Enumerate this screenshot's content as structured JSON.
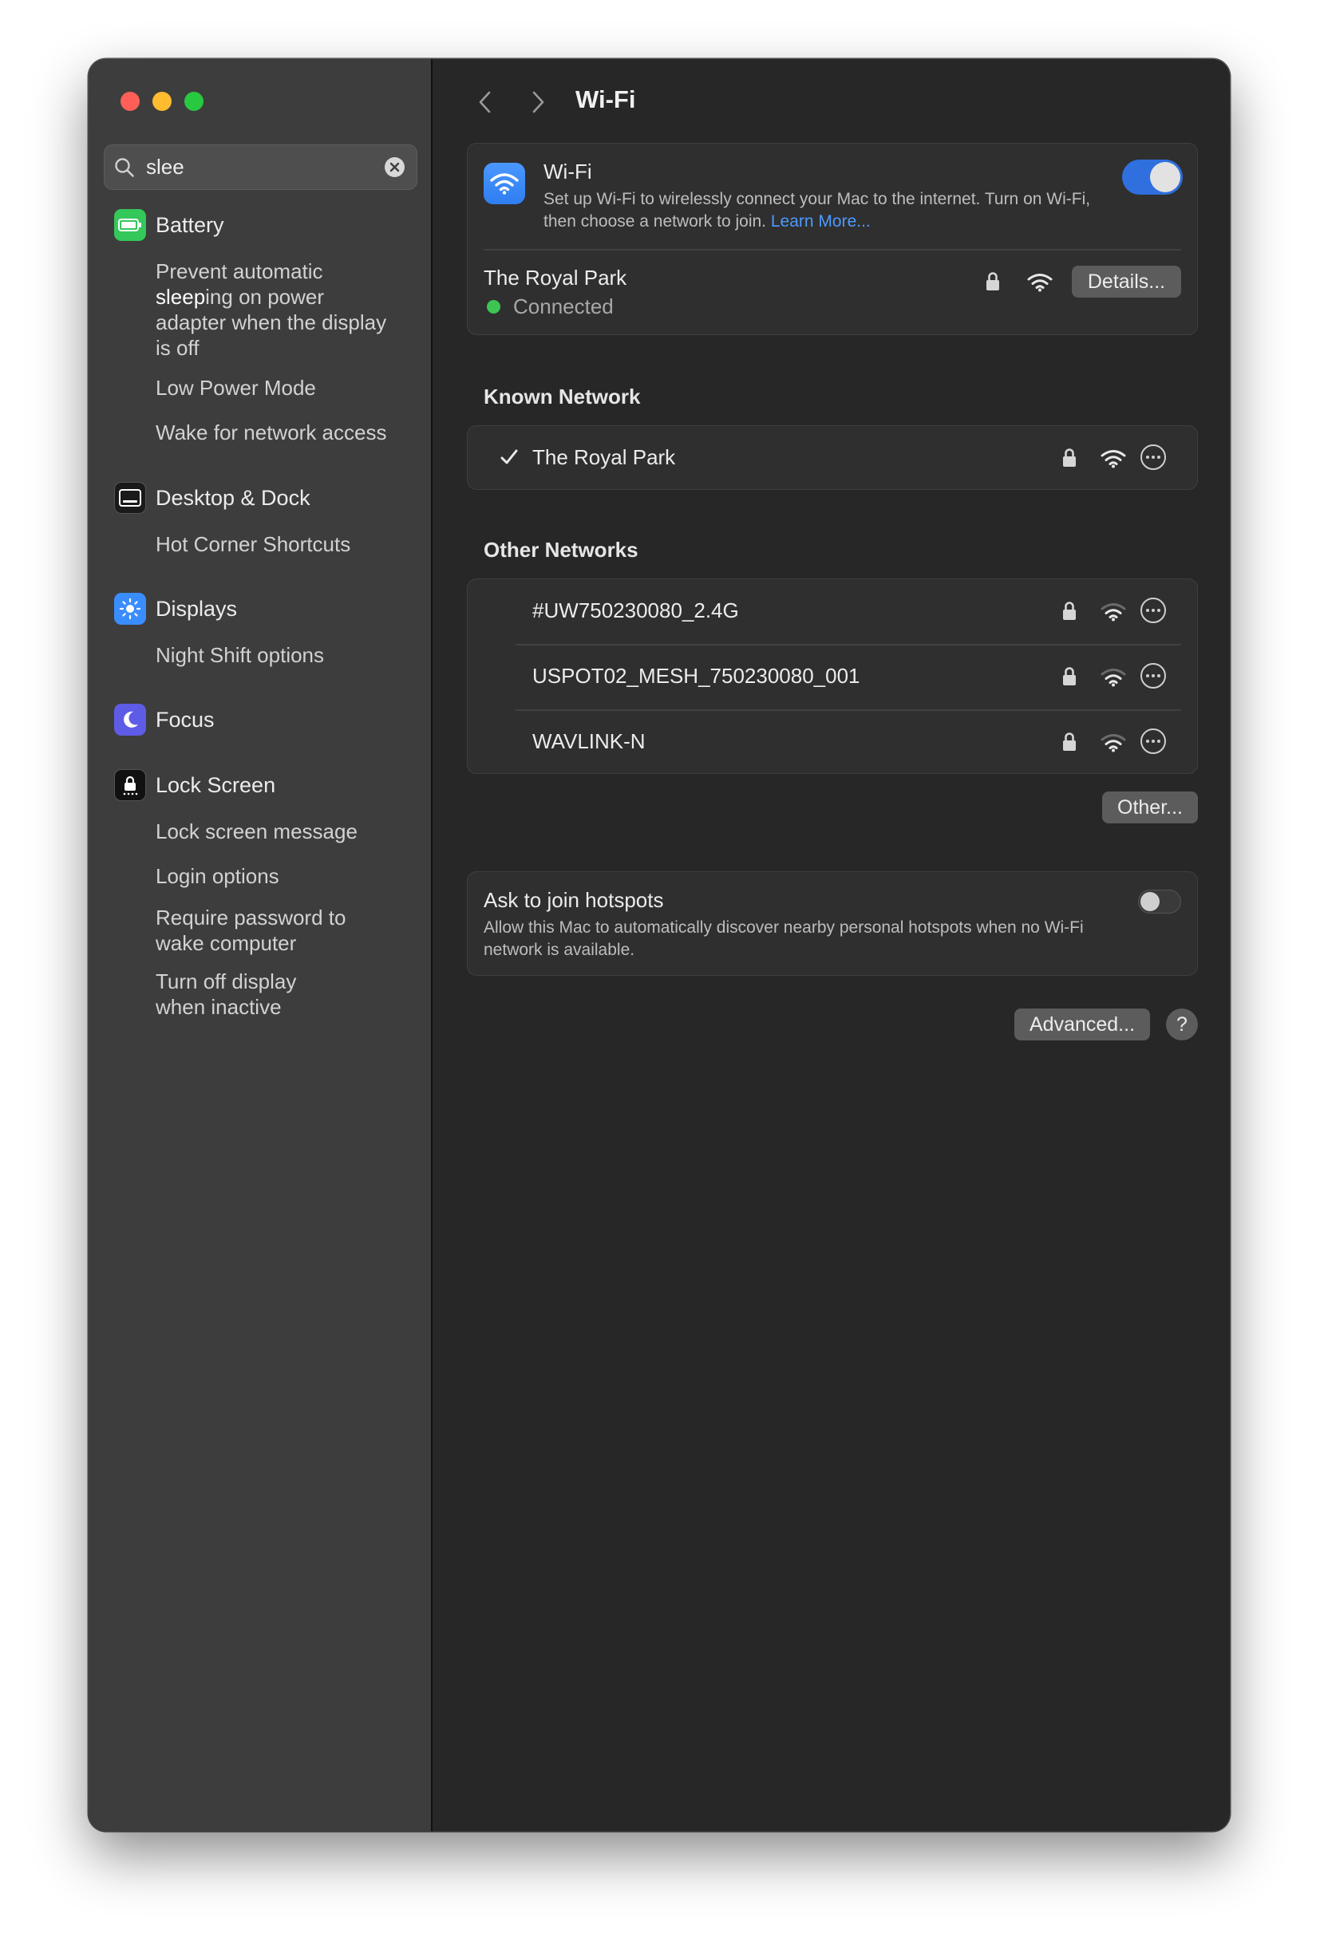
{
  "sidebar": {
    "search": {
      "value": "slee"
    },
    "groups": [
      {
        "label": "Battery",
        "icon": "battery-icon",
        "items": [
          {
            "lines": [
              [
                "Prevent automatic",
                ""
              ],
              [
                "sleep",
                "ing on power"
              ],
              [
                "adapter when the display",
                ""
              ],
              [
                "is off",
                ""
              ]
            ]
          },
          {
            "label": "Low Power Mode"
          },
          {
            "label": "Wake for network access"
          }
        ]
      },
      {
        "label": "Desktop & Dock",
        "icon": "dock-icon",
        "items": [
          {
            "label": "Hot Corner Shortcuts"
          }
        ]
      },
      {
        "label": "Displays",
        "icon": "sun-icon",
        "items": [
          {
            "label": "Night Shift options"
          }
        ]
      },
      {
        "label": "Focus",
        "icon": "moon-icon",
        "items": []
      },
      {
        "label": "Lock Screen",
        "icon": "lock-screen-icon",
        "items": [
          {
            "label": "Lock screen message"
          },
          {
            "label": "Login options"
          },
          {
            "lines": [
              [
                "Require password to",
                ""
              ],
              [
                "wake computer",
                ""
              ]
            ]
          },
          {
            "lines": [
              [
                "Turn off display",
                ""
              ],
              [
                "when inactive",
                ""
              ]
            ]
          }
        ]
      }
    ]
  },
  "main": {
    "title": "Wi-Fi",
    "wifi": {
      "title": "Wi-Fi",
      "description": "Set up Wi-Fi to wirelessly connect your Mac to the internet. Turn on Wi-Fi, then choose a network to join.",
      "learn_more": "Learn More...",
      "enabled": true
    },
    "current": {
      "name": "The Royal Park",
      "status": "Connected",
      "details_label": "Details..."
    },
    "known_label": "Known Network",
    "known": [
      {
        "name": "The Royal Park"
      }
    ],
    "other_label": "Other Networks",
    "other": [
      {
        "name": "#UW750230080_2.4G"
      },
      {
        "name": "USPOT02_MESH_750230080_001"
      },
      {
        "name": "WAVLINK-N"
      }
    ],
    "other_button": "Other...",
    "hotspots": {
      "title": "Ask to join hotspots",
      "description": "Allow this Mac to automatically discover nearby personal hotspots when no Wi-Fi network is available.",
      "enabled": false
    },
    "advanced_button": "Advanced...",
    "help_button": "?"
  },
  "colors": {
    "accent": "#2f6fde",
    "link": "#4c9bff",
    "connected": "#3cc552"
  }
}
